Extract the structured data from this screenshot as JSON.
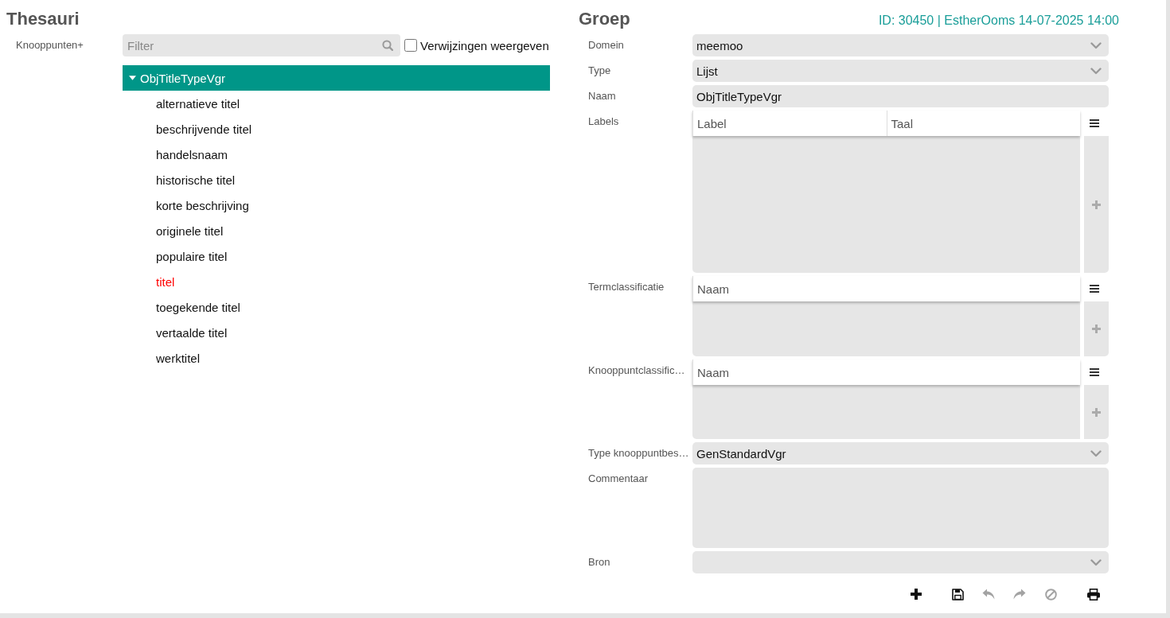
{
  "left_panel": {
    "title": "Thesauri",
    "nodes_label": "Knooppunten+",
    "filter": {
      "placeholder": "Filter"
    },
    "show_references": {
      "label": "Verwijzingen weergeven",
      "checked": false
    },
    "tree": [
      {
        "label": "ObjTitleTypeVgr",
        "expanded": true,
        "selected": true,
        "children": [
          {
            "label": "alternatieve titel",
            "selected": false,
            "color": "#111111"
          },
          {
            "label": "beschrijvende titel",
            "selected": false,
            "color": "#111111"
          },
          {
            "label": "handelsnaam",
            "selected": false,
            "color": "#111111"
          },
          {
            "label": "historische titel",
            "selected": false,
            "color": "#111111"
          },
          {
            "label": "korte beschrijving",
            "selected": false,
            "color": "#111111"
          },
          {
            "label": "originele titel",
            "selected": false,
            "color": "#111111"
          },
          {
            "label": "populaire titel",
            "selected": false,
            "color": "#111111"
          },
          {
            "label": "titel",
            "selected": false,
            "color": "#ff0000"
          },
          {
            "label": "toegekende titel",
            "selected": false,
            "color": "#111111"
          },
          {
            "label": "vertaalde titel",
            "selected": false,
            "color": "#111111"
          },
          {
            "label": "werktitel",
            "selected": false,
            "color": "#111111"
          }
        ]
      }
    ]
  },
  "right_panel": {
    "title": "Groep",
    "record_info": "ID: 30450 | EstherOoms 14-07-2025 14:00",
    "fields": [
      {
        "kind": "select",
        "label": "Domein",
        "value": "meemoo"
      },
      {
        "kind": "select",
        "label": "Type",
        "value": "Lijst"
      },
      {
        "kind": "text",
        "label": "Naam",
        "value": "ObjTitleTypeVgr"
      },
      {
        "kind": "grid",
        "label": "Labels",
        "columns": [
          "Label",
          "Taal"
        ]
      },
      {
        "kind": "grid",
        "label": "Termclassificatie",
        "columns": [
          "Naam"
        ]
      },
      {
        "kind": "grid",
        "label": "Knooppuntclassific…",
        "columns": [
          "Naam"
        ]
      },
      {
        "kind": "select",
        "label": "Type knooppuntbes…",
        "value": "GenStandardVgr"
      },
      {
        "kind": "textarea",
        "label": "Commentaar"
      },
      {
        "kind": "select",
        "label": "Bron"
      }
    ],
    "toolbar": [
      {
        "kind": "add",
        "disabled": false
      },
      {
        "kind": "save",
        "disabled": false
      },
      {
        "kind": "undo",
        "disabled": true
      },
      {
        "kind": "redo",
        "disabled": true
      },
      {
        "kind": "cancel",
        "disabled": true
      },
      {
        "kind": "print",
        "disabled": false
      }
    ]
  }
}
